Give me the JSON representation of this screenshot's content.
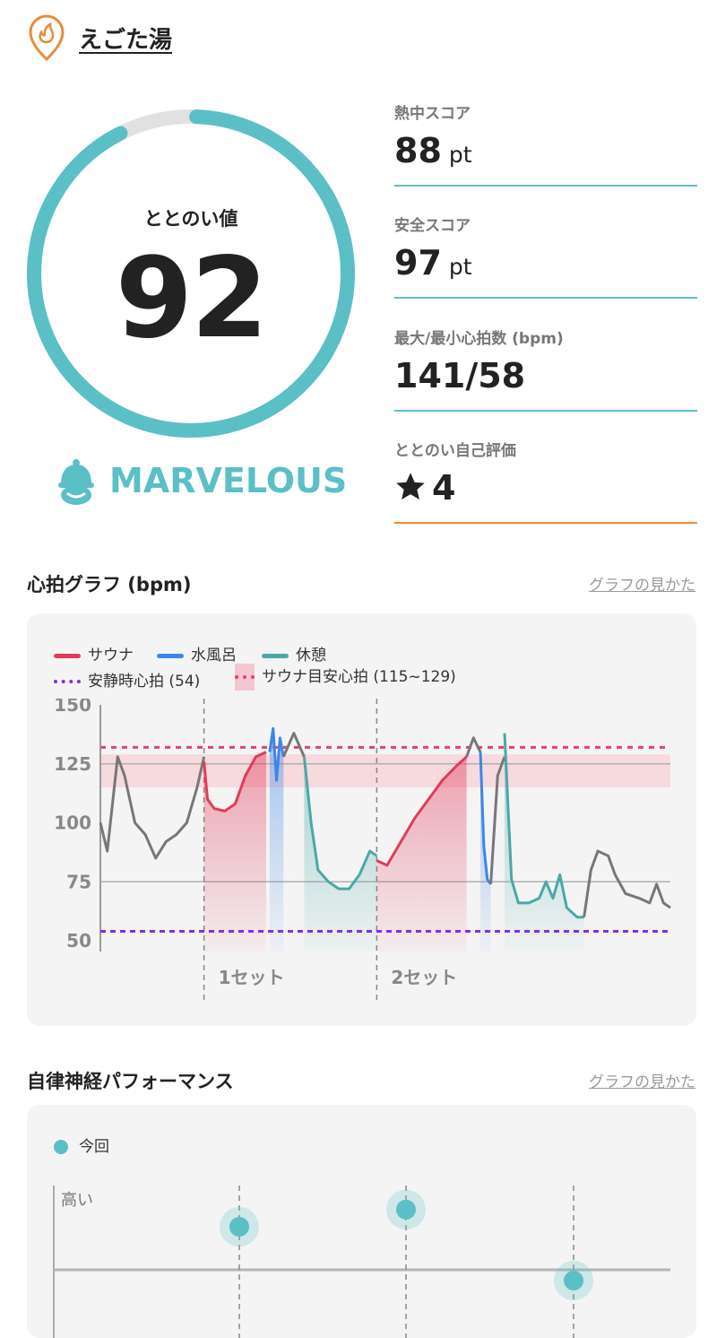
{
  "header": {
    "facility_name": "えごた湯"
  },
  "score": {
    "label": "ととのい値",
    "value": 92,
    "ring_fraction": 0.92,
    "rank": "MARVELOUS"
  },
  "stats": [
    {
      "label": "熱中スコア",
      "value": "88",
      "unit": "pt"
    },
    {
      "label": "安全スコア",
      "value": "97",
      "unit": "pt"
    },
    {
      "label": "最大/最小心拍数 (bpm)",
      "value": "141/58",
      "unit": ""
    },
    {
      "label": "ととのい自己評価",
      "value": "4",
      "unit": ""
    }
  ],
  "heart_section": {
    "title": "心拍グラフ (bpm)",
    "link": "グラフの見かた"
  },
  "heart_legend": {
    "sauna": "サウナ",
    "cold": "水風呂",
    "rest": "休憩",
    "resting": "安静時心拍 (54)",
    "target": "サウナ目安心拍 (115~129)"
  },
  "colors": {
    "sauna": "#e23b5a",
    "cold": "#3d86e8",
    "rest": "#4aa8a8",
    "other": "#777777",
    "resting": "#8a2be2",
    "target": "#e2416a",
    "accent": "#5bbfc6",
    "orange": "#e98b3b"
  },
  "chart_data": {
    "type": "line",
    "ylim": [
      50,
      150
    ],
    "yticks": [
      "150",
      "125",
      "100",
      "75",
      "50"
    ],
    "reference_lines": [
      {
        "name": "安静時心拍",
        "value": 54
      }
    ],
    "target_band": [
      115,
      129
    ],
    "sets": [
      "1セット",
      "2セット"
    ],
    "series": [
      {
        "name": "pre",
        "phase": "other",
        "values": [
          [
            0,
            100
          ],
          [
            2,
            88
          ],
          [
            5,
            128
          ],
          [
            7,
            120
          ],
          [
            10,
            100
          ],
          [
            13,
            95
          ],
          [
            16,
            85
          ],
          [
            19,
            92
          ],
          [
            22,
            95
          ],
          [
            25,
            100
          ],
          [
            28,
            115
          ],
          [
            30,
            128
          ]
        ]
      },
      {
        "name": "sauna1",
        "phase": "sauna",
        "values": [
          [
            30,
            126
          ],
          [
            31,
            110
          ],
          [
            33,
            106
          ],
          [
            36,
            105
          ],
          [
            39,
            108
          ],
          [
            42,
            120
          ],
          [
            45,
            128
          ],
          [
            48,
            130
          ]
        ]
      },
      {
        "name": "cold1",
        "phase": "cold",
        "values": [
          [
            49,
            130
          ],
          [
            50,
            140
          ],
          [
            51,
            118
          ],
          [
            52,
            136
          ],
          [
            53,
            128
          ]
        ]
      },
      {
        "name": "gap1",
        "phase": "other",
        "values": [
          [
            53,
            128
          ],
          [
            56,
            138
          ],
          [
            59,
            128
          ]
        ]
      },
      {
        "name": "rest1",
        "phase": "rest",
        "values": [
          [
            59,
            128
          ],
          [
            61,
            100
          ],
          [
            63,
            80
          ],
          [
            66,
            75
          ],
          [
            69,
            72
          ],
          [
            72,
            72
          ],
          [
            75,
            78
          ],
          [
            78,
            88
          ],
          [
            80,
            86
          ]
        ]
      },
      {
        "name": "sauna2",
        "phase": "sauna",
        "values": [
          [
            80,
            84
          ],
          [
            83,
            82
          ],
          [
            87,
            92
          ],
          [
            91,
            102
          ],
          [
            95,
            110
          ],
          [
            99,
            118
          ],
          [
            103,
            124
          ],
          [
            106,
            128
          ]
        ]
      },
      {
        "name": "gap2",
        "phase": "other",
        "values": [
          [
            106,
            128
          ],
          [
            108,
            136
          ],
          [
            110,
            130
          ]
        ]
      },
      {
        "name": "cold2",
        "phase": "cold",
        "values": [
          [
            110,
            130
          ],
          [
            111,
            90
          ],
          [
            112,
            76
          ],
          [
            113,
            74
          ]
        ]
      },
      {
        "name": "gap3",
        "phase": "other",
        "values": [
          [
            113,
            74
          ],
          [
            115,
            120
          ],
          [
            117,
            128
          ]
        ]
      },
      {
        "name": "rest2",
        "phase": "rest",
        "values": [
          [
            117,
            138
          ],
          [
            119,
            76
          ],
          [
            121,
            66
          ],
          [
            124,
            66
          ],
          [
            127,
            68
          ],
          [
            129,
            75
          ],
          [
            131,
            68
          ],
          [
            133,
            78
          ],
          [
            135,
            64
          ],
          [
            138,
            60
          ],
          [
            140,
            60
          ]
        ]
      },
      {
        "name": "post",
        "phase": "other",
        "values": [
          [
            140,
            60
          ],
          [
            142,
            80
          ],
          [
            144,
            88
          ],
          [
            147,
            86
          ],
          [
            149,
            78
          ],
          [
            152,
            70
          ],
          [
            156,
            68
          ],
          [
            159,
            66
          ],
          [
            161,
            74
          ],
          [
            163,
            66
          ],
          [
            165,
            64
          ]
        ]
      }
    ]
  },
  "ans_section": {
    "title": "自律神経パフォーマンス",
    "link": "グラフの見かた",
    "legend": "今回",
    "y_label": "高い"
  },
  "ans_data": {
    "points": [
      0.7,
      0.78,
      0.45
    ]
  }
}
